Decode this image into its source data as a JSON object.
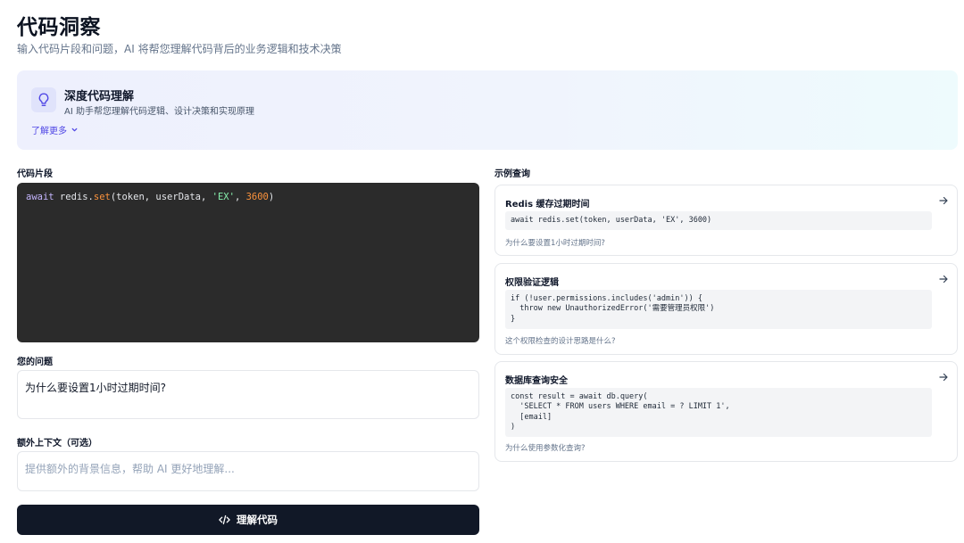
{
  "header": {
    "title": "代码洞察",
    "subtitle": "输入代码片段和问题，AI 将帮您理解代码背后的业务逻辑和技术决策"
  },
  "banner": {
    "icon": "lightbulb-icon",
    "title": "深度代码理解",
    "description": "AI 助手帮您理解代码逻辑、设计决策和实现原理",
    "learn_more": "了解更多"
  },
  "form": {
    "code_label": "代码片段",
    "code_tokens": {
      "kw": "await",
      "obj": " redis.",
      "method": "set",
      "args_open": "(token, userData, ",
      "str": "'EX'",
      "sep": ", ",
      "num": "3600",
      "close": ")"
    },
    "question_label": "您的问题",
    "question_value": "为什么要设置1小时过期时间?",
    "context_label": "额外上下文（可选）",
    "context_placeholder": "提供额外的背景信息，帮助 AI 更好地理解...",
    "submit_label": "理解代码",
    "submit_icon": "code-icon"
  },
  "examples": {
    "label": "示例查询",
    "items": [
      {
        "title": "Redis 缓存过期时间",
        "code": "await redis.set(token, userData, 'EX', 3600)",
        "question": "为什么要设置1小时过期时间?"
      },
      {
        "title": "权限验证逻辑",
        "code": "if (!user.permissions.includes('admin')) {\n  throw new UnauthorizedError('需要管理员权限')\n}",
        "question": "这个权限检查的设计思路是什么?"
      },
      {
        "title": "数据库查询安全",
        "code": "const result = await db.query(\n  'SELECT * FROM users WHERE email = ? LIMIT 1',\n  [email]\n)",
        "question": "为什么使用参数化查询?"
      }
    ]
  },
  "colors": {
    "accent": "#4f46e5",
    "button_bg": "#111827",
    "editor_bg": "#2b2b2b"
  }
}
